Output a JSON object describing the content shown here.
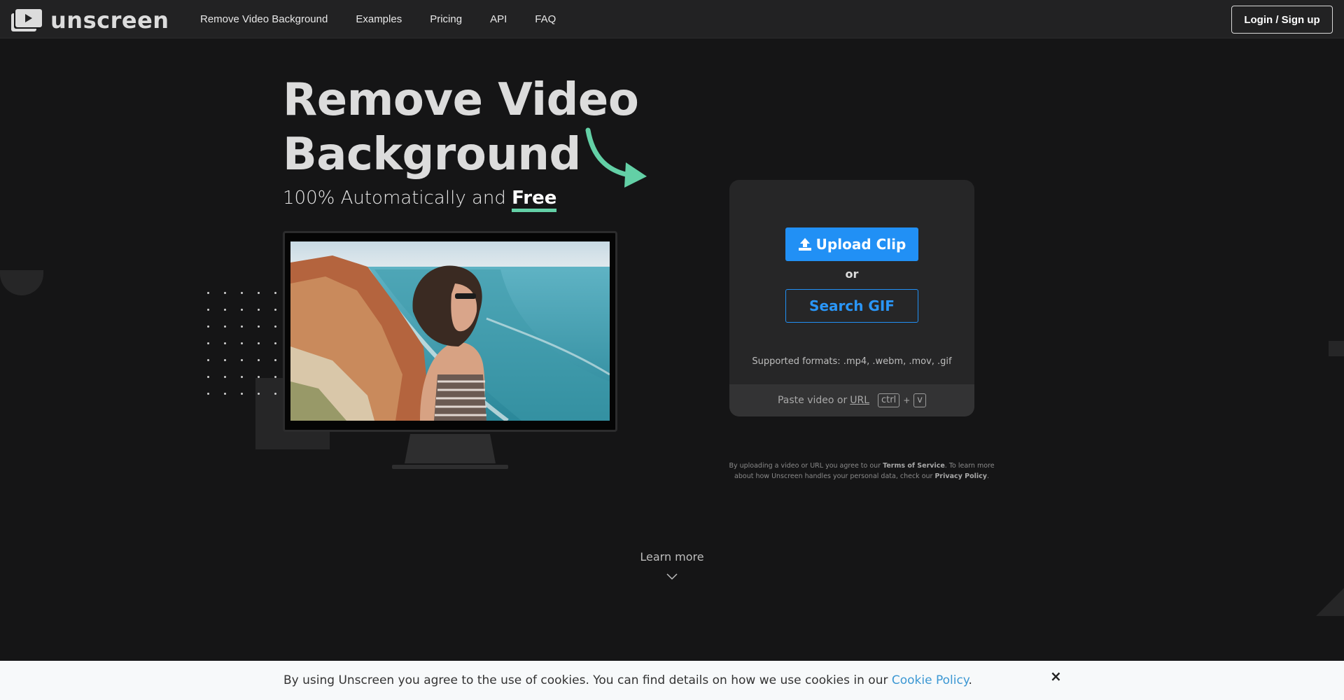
{
  "header": {
    "logo_text": "unscreen",
    "nav": [
      "Remove Video Background",
      "Examples",
      "Pricing",
      "API",
      "FAQ"
    ],
    "login_label": "Login / Sign up"
  },
  "hero": {
    "title": "Remove Video Background",
    "subtitle_prefix": "100% Automatically and ",
    "subtitle_highlight": "Free",
    "accent_color": "#63d0a6"
  },
  "upload": {
    "upload_label": "Upload Clip",
    "or_label": "or",
    "search_label": "Search GIF",
    "formats": "Supported formats: .mp4, .webm, .mov, .gif",
    "paste_prefix": "Paste video or",
    "paste_url": "URL",
    "key_ctrl": "ctrl",
    "key_plus": "+",
    "key_v": "v",
    "accent_color": "#2190f5"
  },
  "terms": {
    "part1": "By uploading a video or URL you agree to our ",
    "tos": "Terms of Service",
    "part2": ". To learn more about how Unscreen handles your personal data, check our ",
    "privacy": "Privacy Policy",
    "part3": "."
  },
  "learn_more": "Learn more",
  "cookie": {
    "text": "By using Unscreen you agree to the use of cookies. You can find details on how we use cookies in our ",
    "link": "Cookie Policy",
    "suffix": ".",
    "close": "×"
  }
}
